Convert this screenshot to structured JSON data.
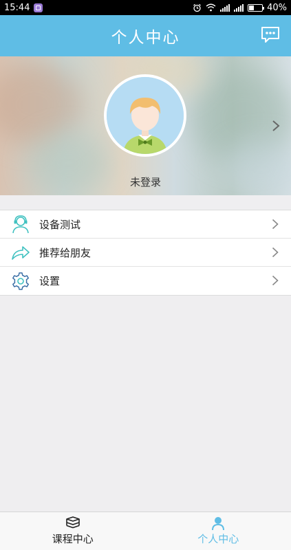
{
  "status_bar": {
    "time": "15:44",
    "battery": "40%",
    "battery_level": 0.4
  },
  "header": {
    "title": "个人中心",
    "message_icon": "chat-bubble-icon"
  },
  "profile": {
    "login_status": "未登录",
    "avatar_icon": "default-avatar-icon"
  },
  "menu": {
    "items": [
      {
        "label": "设备测试",
        "icon": "headset-user-icon"
      },
      {
        "label": "推荐给朋友",
        "icon": "share-arrow-icon"
      },
      {
        "label": "设置",
        "icon": "gear-icon"
      }
    ]
  },
  "tabbar": {
    "tabs": [
      {
        "label": "课程中心",
        "icon": "books-icon",
        "active": false
      },
      {
        "label": "个人中心",
        "icon": "person-icon",
        "active": true
      }
    ]
  },
  "colors": {
    "primary": "#5fbde5",
    "background": "#efeef0",
    "icon_teal": "#3fc1c0",
    "icon_blue": "#3a6ea5"
  }
}
